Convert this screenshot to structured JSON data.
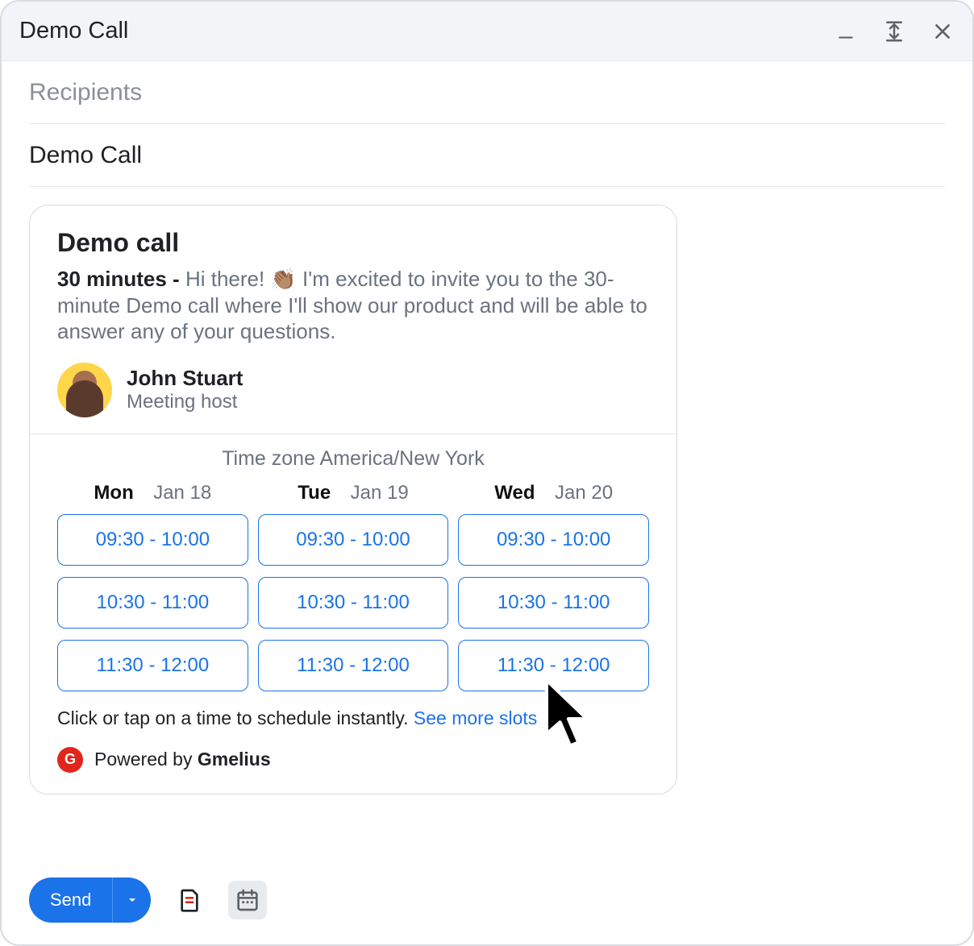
{
  "header": {
    "title": "Demo Call"
  },
  "fields": {
    "recipients_placeholder": "Recipients",
    "subject": "Demo Call"
  },
  "card": {
    "title": "Demo call",
    "duration_label": "30 minutes - ",
    "description": "Hi there! 👏🏽 I'm excited to invite you to the 30-minute Demo call where I'll show our product and will be able to answer any of your questions.",
    "host": {
      "name": "John Stuart",
      "role": "Meeting host"
    },
    "timezone_label": "Time zone America/New York",
    "days": [
      {
        "dow": "Mon",
        "date": "Jan 18",
        "slots": [
          "09:30 - 10:00",
          "10:30 - 11:00",
          "11:30 - 12:00"
        ]
      },
      {
        "dow": "Tue",
        "date": "Jan 19",
        "slots": [
          "09:30 - 10:00",
          "10:30 - 11:00",
          "11:30 - 12:00"
        ]
      },
      {
        "dow": "Wed",
        "date": "Jan 20",
        "slots": [
          "09:30 - 10:00",
          "10:30 - 11:00",
          "11:30 - 12:00"
        ]
      }
    ],
    "instruction": "Click or tap on a time to schedule instantly. ",
    "see_more": "See more slots",
    "powered_prefix": "Powered by ",
    "powered_brand": "Gmelius"
  },
  "footer": {
    "send_label": "Send"
  }
}
